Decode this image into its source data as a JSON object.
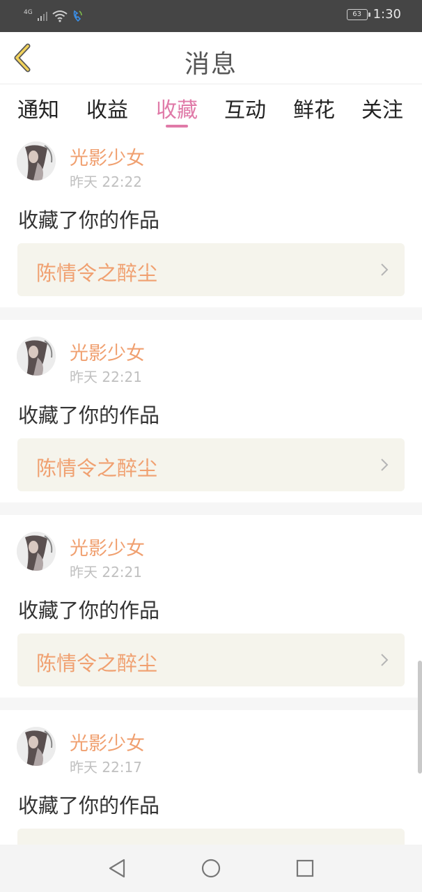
{
  "status_bar": {
    "network": "4G",
    "battery": "63",
    "time": "1:30"
  },
  "header": {
    "title": "消息"
  },
  "tabs": [
    {
      "label": "通知",
      "active": false
    },
    {
      "label": "收益",
      "active": false
    },
    {
      "label": "收藏",
      "active": true
    },
    {
      "label": "互动",
      "active": false
    },
    {
      "label": "鲜花",
      "active": false
    },
    {
      "label": "关注",
      "active": false
    }
  ],
  "colors": {
    "accent": "#e07aa8",
    "username": "#f0a070",
    "work_box_bg": "#f5f4ec"
  },
  "messages": [
    {
      "username": "光影少女",
      "time": "昨天 22:22",
      "action": "收藏了你的作品",
      "work_title": "陈情令之醉尘"
    },
    {
      "username": "光影少女",
      "time": "昨天 22:21",
      "action": "收藏了你的作品",
      "work_title": "陈情令之醉尘"
    },
    {
      "username": "光影少女",
      "time": "昨天 22:21",
      "action": "收藏了你的作品",
      "work_title": "陈情令之醉尘"
    },
    {
      "username": "光影少女",
      "time": "昨天 22:17",
      "action": "收藏了你的作品",
      "work_title": ""
    }
  ]
}
